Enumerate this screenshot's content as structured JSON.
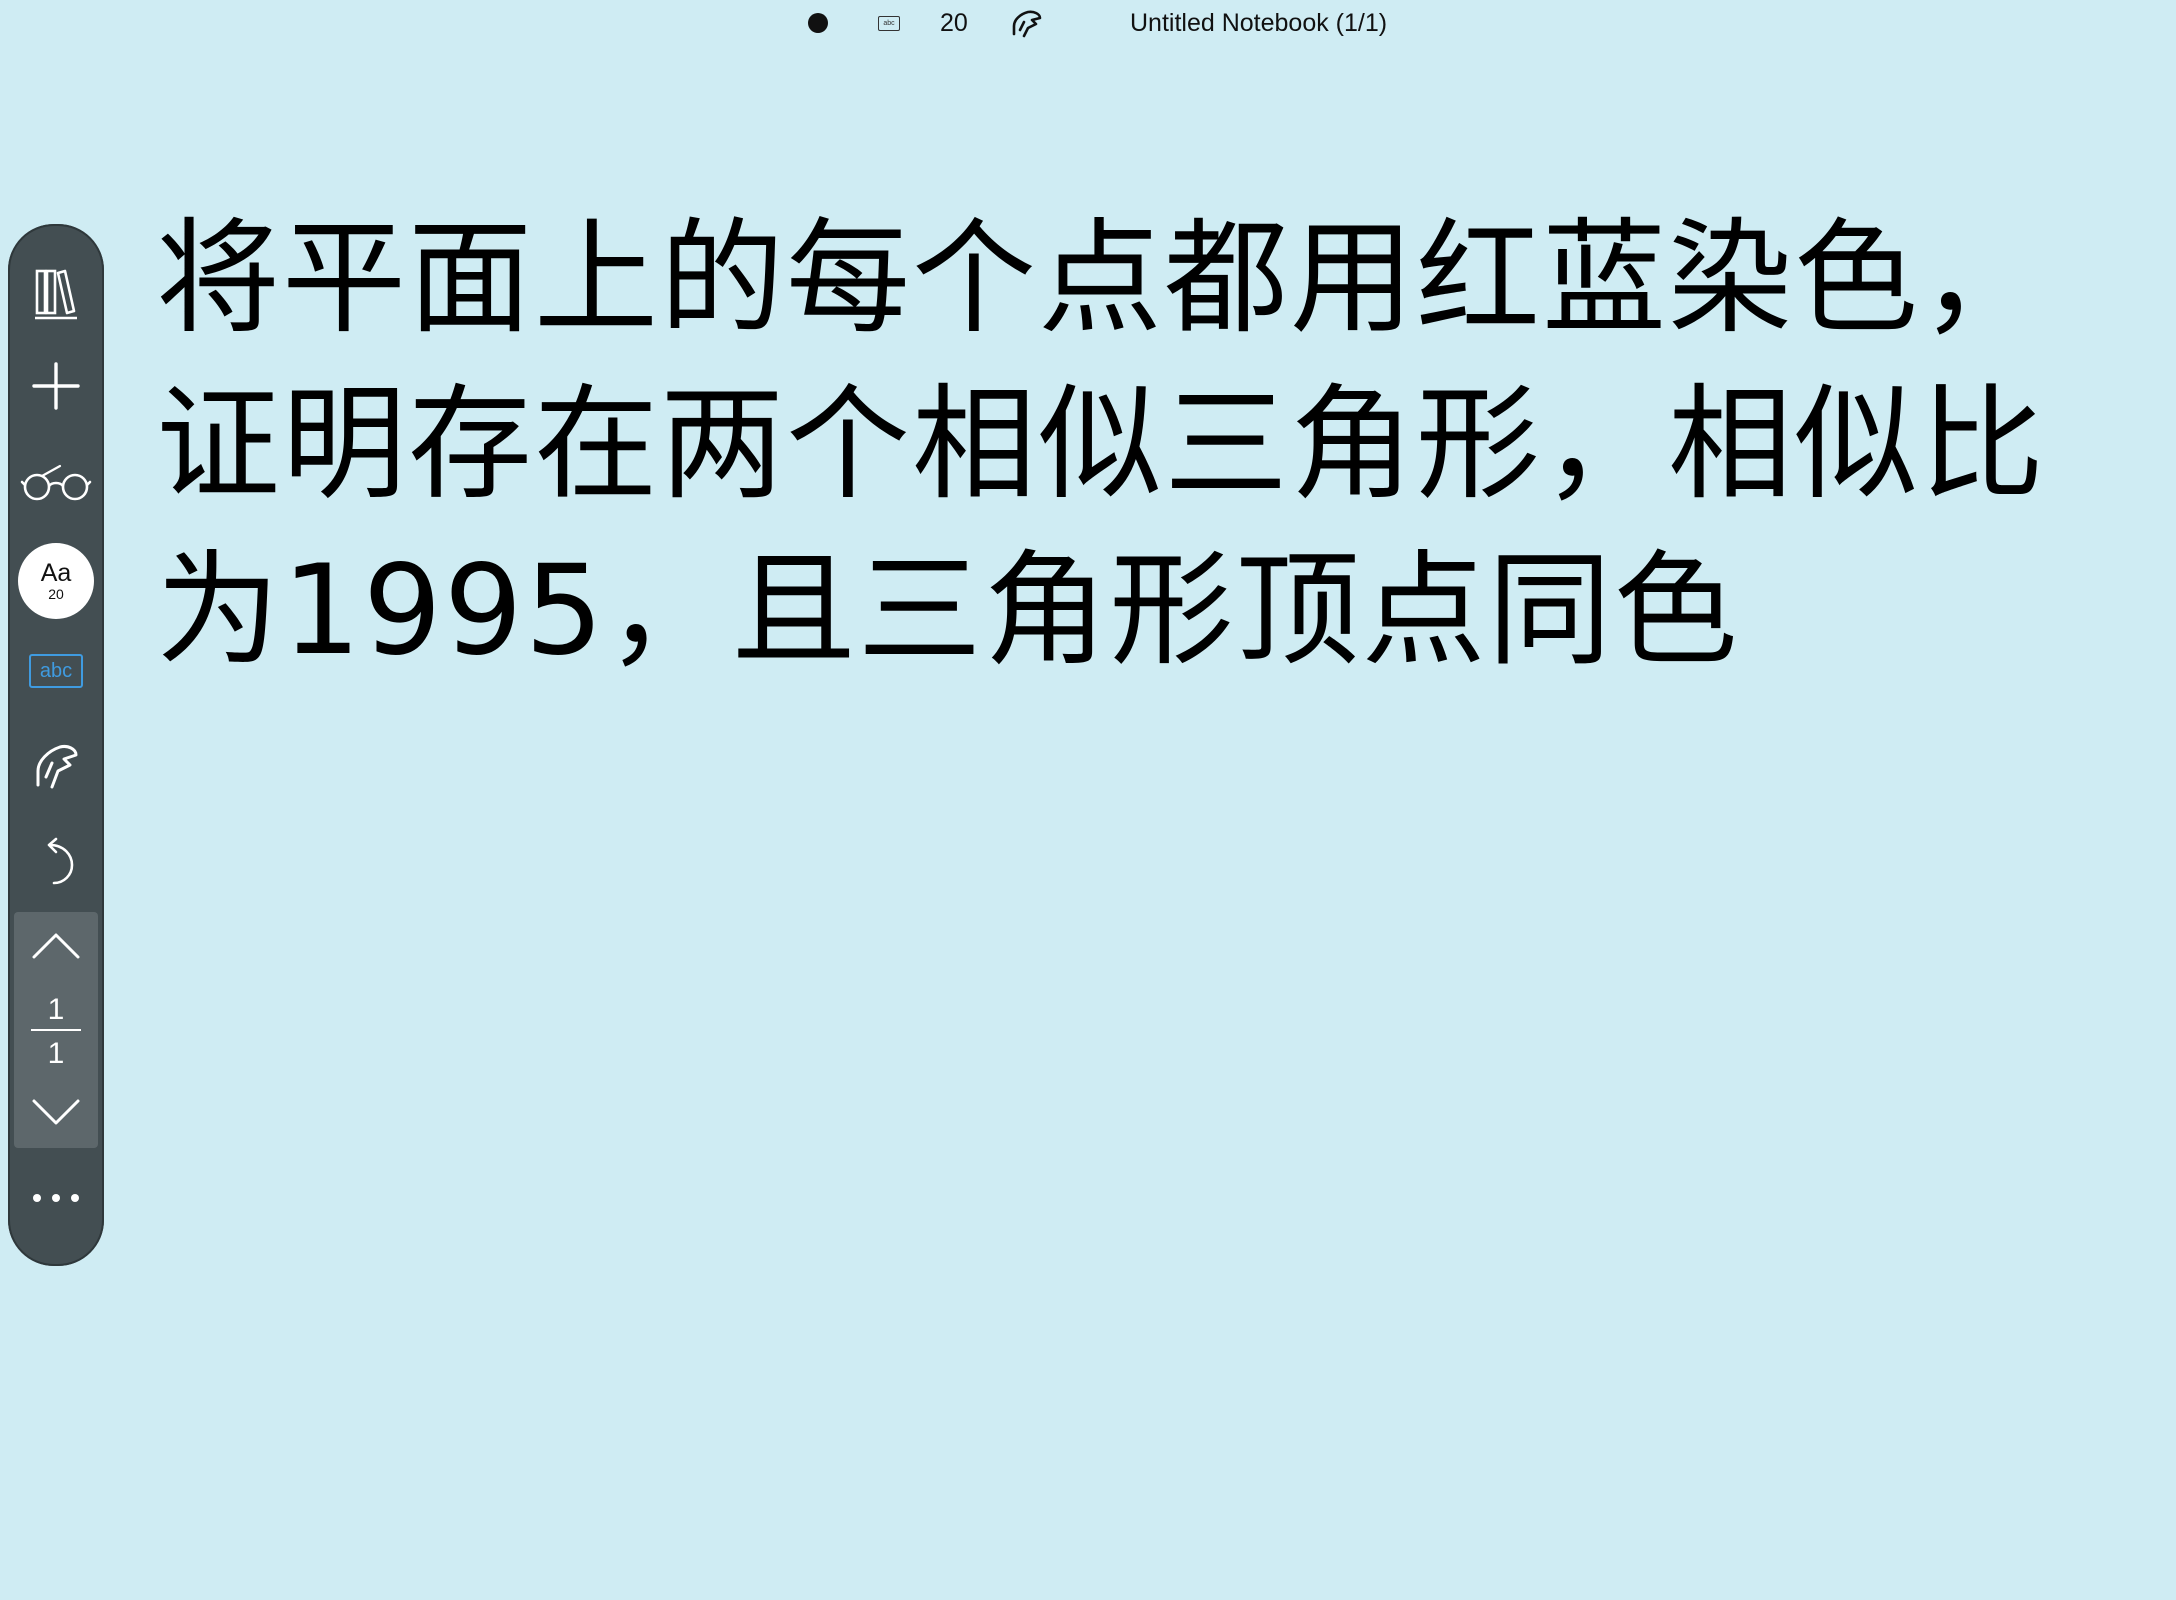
{
  "statusbar": {
    "font_size": "20",
    "notebook_title": "Untitled Notebook (1/1)"
  },
  "toolbar": {
    "font_label": "Aa",
    "font_size": "20",
    "text_mode_label": "abc",
    "page_current": "1",
    "page_total": "1",
    "more_label": "•••"
  },
  "content": {
    "lines": [
      "将平面上的每个点都用红蓝染色，",
      "证明存在两个相似三角形，相似比",
      "为1995，且三角形顶点同色"
    ]
  },
  "colors": {
    "background": "#cfecf3",
    "toolbar": "#434e52",
    "text_mode_accent": "#3f9be0"
  }
}
